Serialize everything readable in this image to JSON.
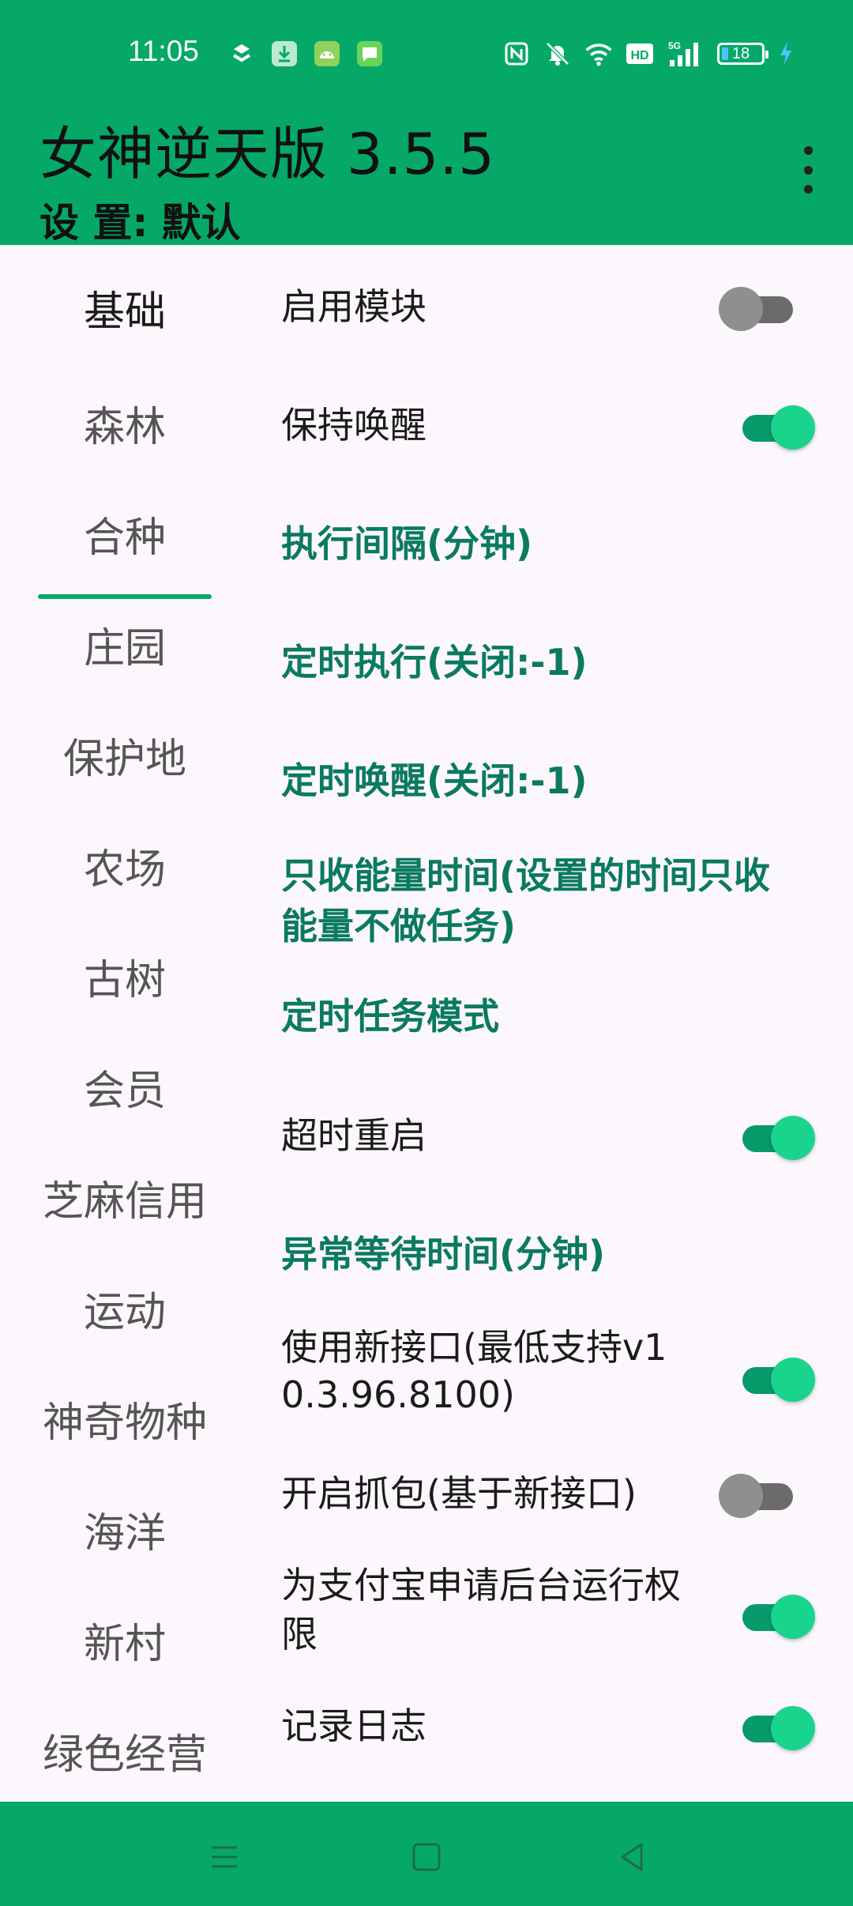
{
  "status_bar": {
    "time": "11:05",
    "battery_level": "18",
    "left_icons": [
      "nfc-tag-icon",
      "download-icon",
      "android-icon",
      "message-icon"
    ],
    "right_icons": [
      "nfc-icon",
      "mute-icon",
      "wifi-icon",
      "hd-icon",
      "signal-5g-icon",
      "battery-icon",
      "charging-icon"
    ],
    "hd_label": "HD",
    "network_label": "5G"
  },
  "app_bar": {
    "title": "女神逆天版 3.5.5",
    "subtitle": "设 置: 默认"
  },
  "sidebar": {
    "active_index": 0,
    "tabs": [
      {
        "label": "基础"
      },
      {
        "label": "森林"
      },
      {
        "label": "合种"
      },
      {
        "label": "庄园"
      },
      {
        "label": "保护地"
      },
      {
        "label": "农场"
      },
      {
        "label": "古树"
      },
      {
        "label": "会员"
      },
      {
        "label": "芝麻信用"
      },
      {
        "label": "运动"
      },
      {
        "label": "神奇物种"
      },
      {
        "label": "海洋"
      },
      {
        "label": "新村"
      },
      {
        "label": "绿色经营"
      }
    ]
  },
  "settings": {
    "items": [
      {
        "label": "启用模块",
        "type": "toggle",
        "checked": false
      },
      {
        "label": "保持唤醒",
        "type": "toggle",
        "checked": true
      },
      {
        "label": "执行间隔(分钟)",
        "type": "link"
      },
      {
        "label": "定时执行(关闭:-1)",
        "type": "link"
      },
      {
        "label": "定时唤醒(关闭:-1)",
        "type": "link"
      },
      {
        "label": "只收能量时间(设置的时间只收能量不做任务)",
        "type": "link"
      },
      {
        "label": "定时任务模式",
        "type": "link"
      },
      {
        "label": "超时重启",
        "type": "toggle",
        "checked": true
      },
      {
        "label": "异常等待时间(分钟)",
        "type": "link"
      },
      {
        "label": "使用新接口(最低支持v10.3.96.8100)",
        "type": "toggle",
        "checked": true
      },
      {
        "label": "开启抓包(基于新接口)",
        "type": "toggle",
        "checked": false
      },
      {
        "label": "为支付宝申请后台运行权限",
        "type": "toggle",
        "checked": true
      },
      {
        "label": "记录日志",
        "type": "toggle",
        "checked": true
      }
    ]
  },
  "nav_bar": {
    "buttons": [
      "menu-icon",
      "home-icon",
      "back-icon"
    ]
  },
  "colors": {
    "primary": "#06a868",
    "link_text": "#0a7a60",
    "toggle_on_thumb": "#19d48c",
    "toggle_on_track": "#079a6a",
    "background": "#fcf7fc"
  }
}
